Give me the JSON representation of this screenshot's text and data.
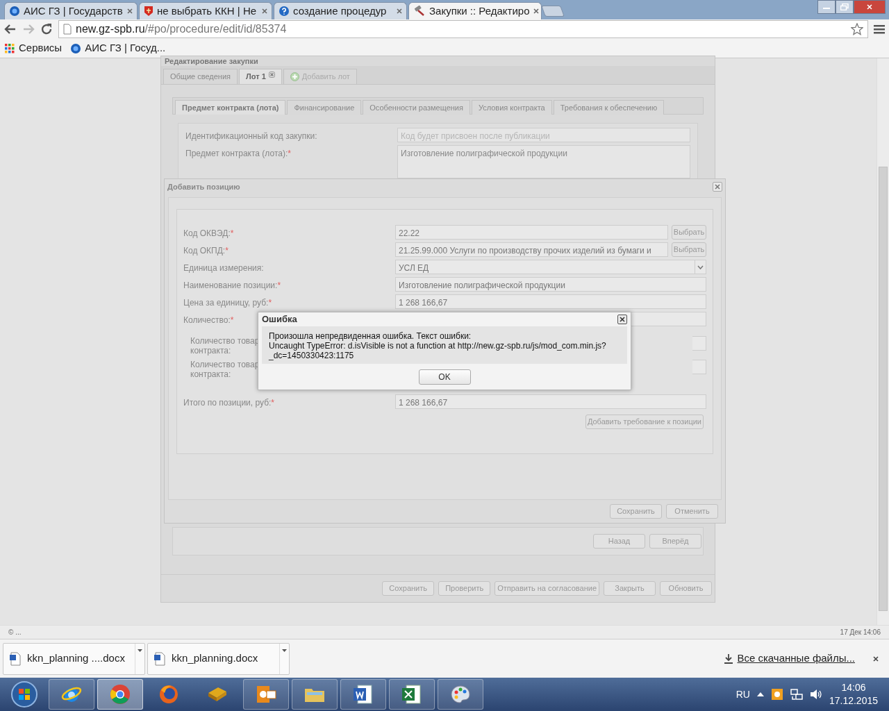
{
  "browser": {
    "tabs": [
      {
        "title": "АИС ГЗ | Государств",
        "kind": "globe",
        "selected": false
      },
      {
        "title": "не выбрать ККН | Не",
        "kind": "crest",
        "selected": false
      },
      {
        "title": "создание процедур",
        "kind": "help",
        "selected": false
      },
      {
        "title": "Закупки :: Редактиро",
        "kind": "hammer",
        "selected": true
      }
    ],
    "address": {
      "host": "new.gz-spb.ru",
      "path": "/#po/procedure/edit/id/85374"
    },
    "bookmarks": [
      {
        "label": "Сервисы",
        "kind": "apps"
      },
      {
        "label": "АИС ГЗ | Госуд...",
        "kind": "globe"
      }
    ]
  },
  "page": {
    "title": "Редактирование закупки",
    "tabs": [
      {
        "label": "Общие сведения",
        "kind": "tab",
        "selected": false
      },
      {
        "label": "Лот 1",
        "kind": "closable",
        "selected": true
      },
      {
        "label": "Добавить лот",
        "kind": "add",
        "selected": false
      }
    ],
    "sub_tabs": [
      {
        "label": "Предмет контракта (лота)",
        "selected": true
      },
      {
        "label": "Финансирование",
        "selected": false
      },
      {
        "label": "Особенности размещения",
        "selected": false
      },
      {
        "label": "Условия контракта",
        "selected": false
      },
      {
        "label": "Требования к обеспечению",
        "selected": false
      }
    ],
    "fields": [
      {
        "label": "Идентификационный код закупки:",
        "kind": "text",
        "placeholder": "Код будет присвоен после публикации"
      },
      {
        "label": "Предмет контракта (лота):",
        "required_mark": "*",
        "kind": "textarea",
        "value": "Изготовление полиграфической продукции"
      }
    ],
    "nav_buttons": [
      "Назад",
      "Вперёд"
    ],
    "footer_buttons": [
      "Сохранить",
      "Проверить",
      "Отправить на согласование",
      "Закрыть",
      "Обновить"
    ]
  },
  "position_dialog": {
    "title": "Добавить позицию",
    "fields": [
      {
        "kind": "picker",
        "label": "Код ОКВЭД:",
        "required_mark": "*",
        "value": "22.22",
        "button": "Выбрать"
      },
      {
        "kind": "picker",
        "label": "Код ОКПД:",
        "required_mark": "*",
        "value": "21.25.99.000 Услуги по производству прочих изделий из бумаги и",
        "button": "Выбрать"
      },
      {
        "kind": "select",
        "label": "Единица измерения:",
        "value": "УСЛ ЕД"
      },
      {
        "kind": "text",
        "label": "Наименование позиции:",
        "required_mark": "*",
        "value": "Изготовление полиграфической продукции"
      },
      {
        "kind": "text",
        "label": "Цена за единицу, руб:",
        "required_mark": "*",
        "value": "1 268 166,67"
      },
      {
        "kind": "text",
        "label": "Количество:",
        "required_mark": "*"
      },
      {
        "kind": "sub",
        "label_lines": [
          "Количество товар",
          "контракта:"
        ]
      },
      {
        "kind": "sub",
        "label_lines": [
          "Количество товар",
          "контракта:"
        ]
      },
      {
        "kind": "total",
        "label": "Итого по позиции, руб:",
        "required_mark": "*",
        "value": "1 268 166,67"
      }
    ],
    "add_requirement": "Добавить требование к позиции",
    "buttons": [
      "Сохранить",
      "Отменить"
    ]
  },
  "error_dialog": {
    "title": "Ошибка",
    "lines": [
      "Произошла непредвиденная ошибка. Текст ошибки:",
      "Uncaught TypeError: d.isVisible is not a function at http://new.gz-spb.ru/js/mod_com.min.js?",
      "_dc=1450330423:1175"
    ],
    "button": "OK"
  },
  "status_bar": {
    "left": "© ...",
    "right": "17 Дек 14:06"
  },
  "downloads": {
    "items": [
      "kkn_planning ....docx",
      "kkn_planning.docx"
    ],
    "show_all": "Все скачанные файлы..."
  },
  "taskbar": {
    "apps": [
      {
        "kind": "ie",
        "running": true,
        "selected": false
      },
      {
        "kind": "chrome",
        "running": true,
        "selected": true
      },
      {
        "kind": "firefox",
        "running": false,
        "selected": false
      },
      {
        "kind": "book",
        "running": false,
        "selected": false
      },
      {
        "kind": "outlook",
        "running": true,
        "selected": false
      },
      {
        "kind": "explorer",
        "running": true,
        "selected": false
      },
      {
        "kind": "word",
        "running": true,
        "selected": false
      },
      {
        "kind": "excel",
        "running": true,
        "selected": false
      },
      {
        "kind": "paint",
        "running": true,
        "selected": false
      }
    ],
    "language": "RU",
    "time": "14:06",
    "date": "17.12.2015"
  }
}
